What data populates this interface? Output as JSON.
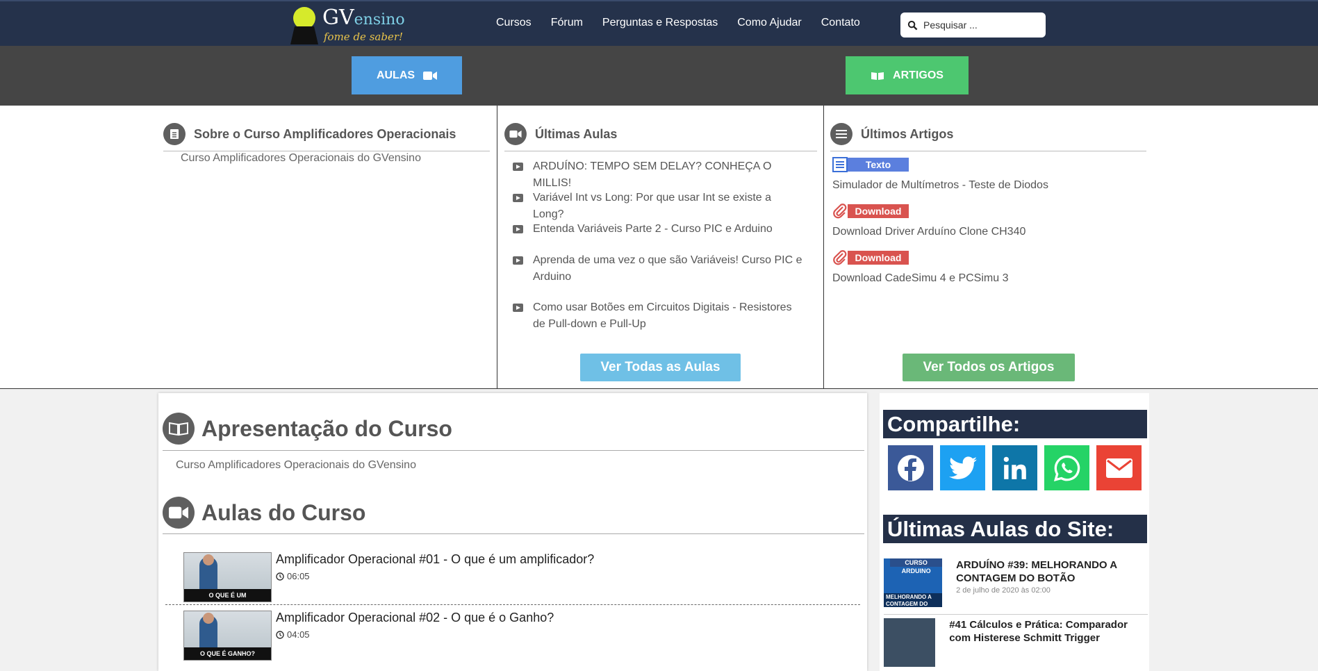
{
  "header": {
    "logo_main": "GV",
    "logo_rest": "ensino",
    "logo_tagline": "fome de saber!",
    "nav": [
      "Cursos",
      "Fórum",
      "Perguntas e Respostas",
      "Como Ajudar",
      "Contato"
    ],
    "search_placeholder": "Pesquisar ..."
  },
  "band": {
    "aulas_label": "AULAS",
    "artigos_label": "ARTIGOS"
  },
  "sobre": {
    "title": "Sobre o Curso Amplificadores Operacionais",
    "text": "Curso Amplificadores Operacionais do GVensino"
  },
  "ultimas_aulas": {
    "title": "Últimas Aulas",
    "items": [
      "ARDUÍNO: TEMPO SEM DELAY? CONHEÇA O MILLIS!",
      "Variável Int vs Long: Por que usar Int se existe a Long?",
      "Entenda Variáveis Parte 2 - Curso PIC e Arduino",
      "Aprenda de uma vez o que são Variáveis! Curso PIC e Arduino",
      "Como usar Botões em Circuitos Digitais - Resistores de Pull-down e Pull-Up"
    ],
    "button": "Ver Todas as Aulas"
  },
  "ultimos_artigos": {
    "title": "Últimos Artigos",
    "items": [
      {
        "tag": "Texto",
        "title": "Simulador de Multímetros - Teste de Diodos",
        "color": "#5b7fde"
      },
      {
        "tag": "Download",
        "title": "Download Driver Arduíno Clone CH340",
        "color": "#d9534f"
      },
      {
        "tag": "Download",
        "title": "Download CadeSimu 4 e PCSimu 3",
        "color": "#d9534f"
      }
    ],
    "button": "Ver Todos os Artigos"
  },
  "main": {
    "apresentacao_title": "Apresentação do Curso",
    "apresentacao_text": "Curso Amplificadores Operacionais do GVensino",
    "aulas_title": "Aulas do Curso",
    "lessons": [
      {
        "title": "Amplificador Operacional #01 - O que é um amplificador?",
        "duration": "06:05",
        "thumb_caption": "O QUE É UM AMPLIFICADOR?"
      },
      {
        "title": "Amplificador Operacional #02 - O que é o Ganho?",
        "duration": "04:05",
        "thumb_caption": "O QUE É GANHO?"
      }
    ]
  },
  "sidebar": {
    "share_title": "Compartilhe:",
    "share": [
      {
        "name": "facebook-icon",
        "color": "#3b5998"
      },
      {
        "name": "twitter-icon",
        "color": "#1da1f2"
      },
      {
        "name": "linkedin-icon",
        "color": "#0077b5"
      },
      {
        "name": "whatsapp-icon",
        "color": "#25d366"
      },
      {
        "name": "email-icon",
        "color": "#ea4335"
      }
    ],
    "latest_title": "Últimas Aulas do Site:",
    "latest": [
      {
        "title": "ARDUÍNO #39: MELHORANDO A CONTAGEM DO BOTÃO",
        "date": "2 de julho de 2020 às 02:00",
        "thumb_top": "CURSO ARDUINO",
        "thumb_caption": "MELHORANDO A CONTAGEM DO BOTÃO"
      },
      {
        "title": "#41 Cálculos e Prática: Comparador com Histerese Schmitt Trigger",
        "date": "",
        "thumb_top": "",
        "thumb_caption": ""
      }
    ]
  }
}
